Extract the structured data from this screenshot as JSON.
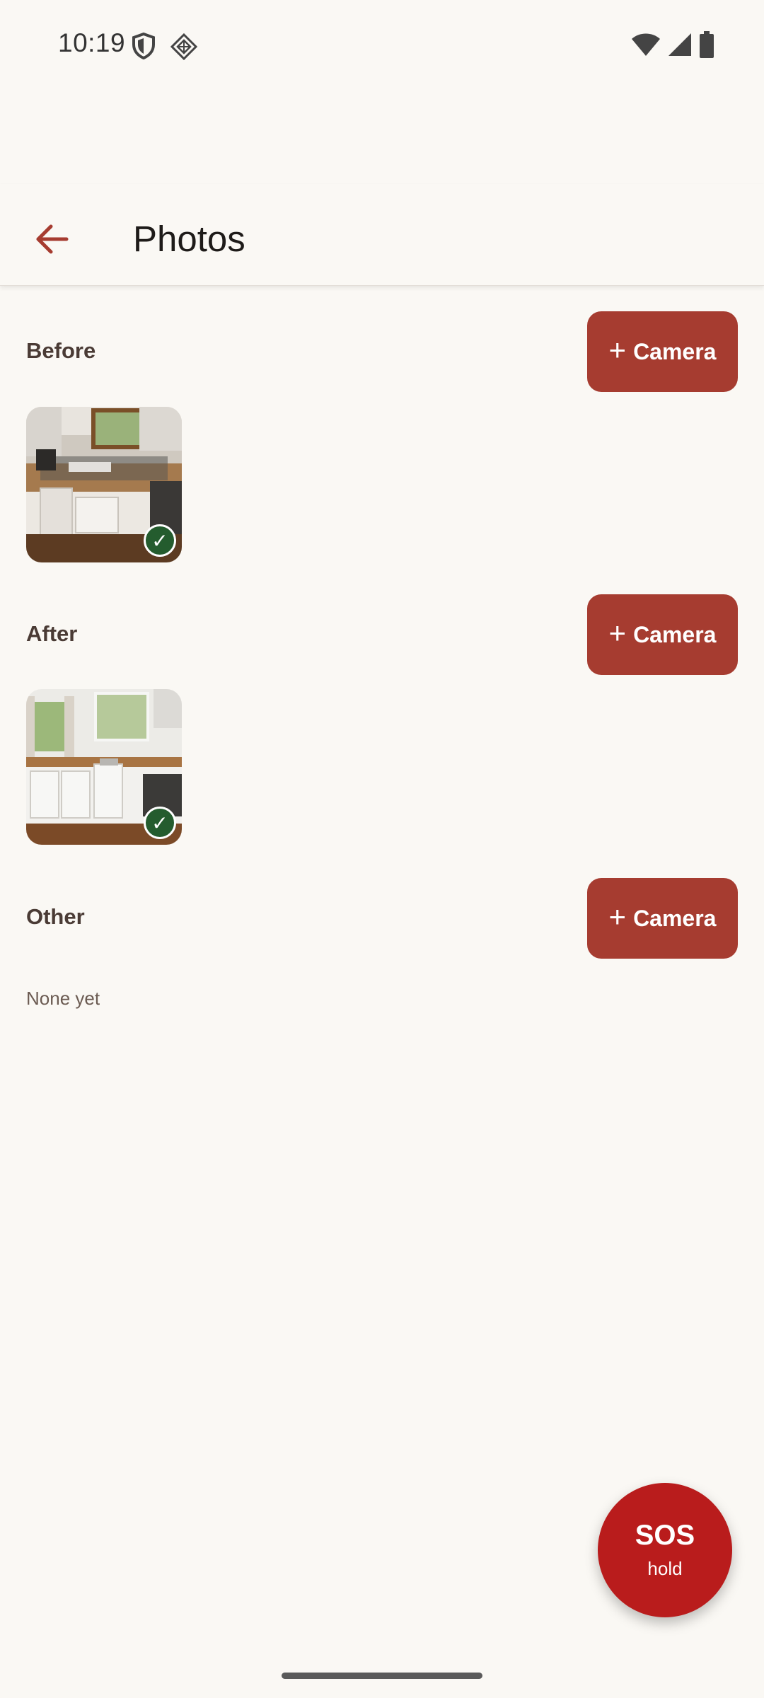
{
  "status_bar": {
    "time": "10:19",
    "icons": [
      "shield-icon",
      "vpn-icon",
      "wifi-icon",
      "signal-icon",
      "battery-icon"
    ]
  },
  "app_bar": {
    "back_icon": "back-arrow-icon",
    "title": "Photos"
  },
  "sections": [
    {
      "label": "Before",
      "camera_label": "Camera",
      "photos": [
        {
          "subject": "cluttered kitchen",
          "uploaded": true
        }
      ]
    },
    {
      "label": "After",
      "camera_label": "Camera",
      "photos": [
        {
          "subject": "clean kitchen",
          "uploaded": true
        }
      ]
    },
    {
      "label": "Other",
      "camera_label": "Camera",
      "photos": [],
      "empty_text": "None yet"
    }
  ],
  "sos": {
    "title": "SOS",
    "subtitle": "hold"
  },
  "colors": {
    "background": "#faf8f4",
    "accent": "#a63c30",
    "sos": "#b91c1c",
    "check": "#245c2e",
    "section_text": "#4a3b35"
  }
}
